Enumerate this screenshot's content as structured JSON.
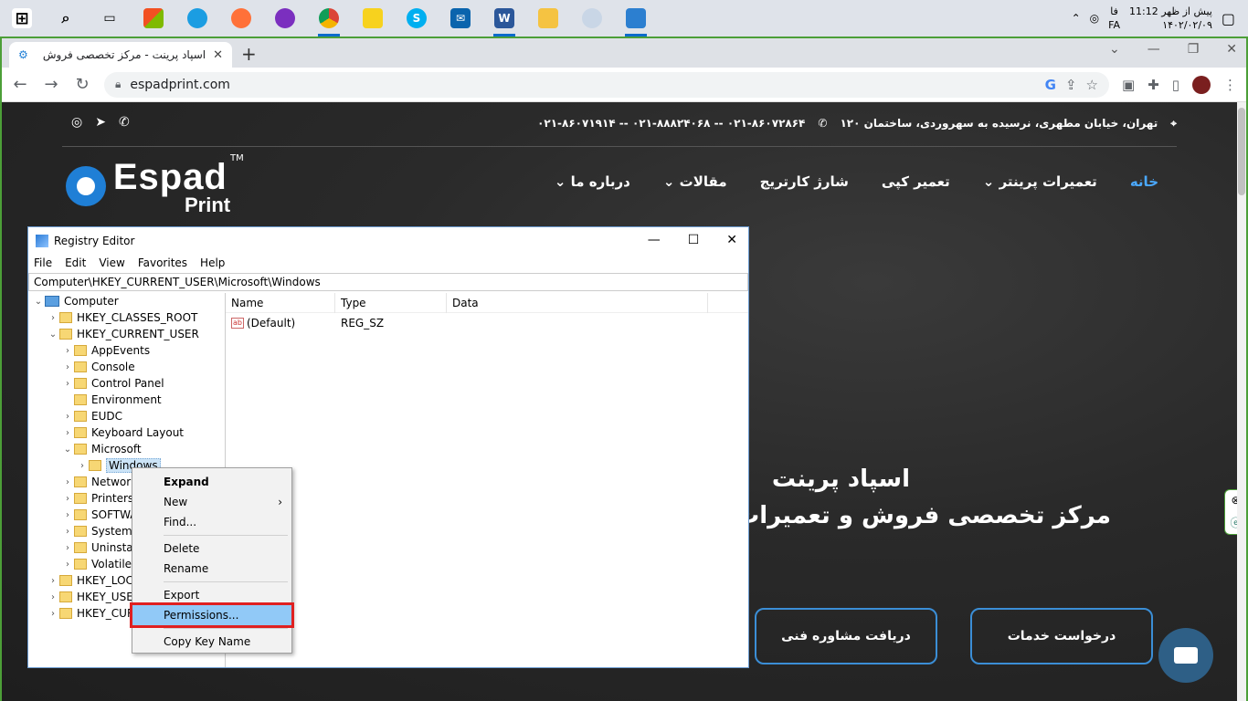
{
  "taskbar": {
    "icons": [
      "windows-start-icon",
      "search-icon",
      "task-view-icon",
      "store-icon",
      "edge-icon",
      "firefox-icon",
      "app-icon",
      "chrome-icon",
      "sticky-notes-icon",
      "skype-icon",
      "mail-icon",
      "word-icon",
      "file-explorer-icon",
      "paint-icon",
      "app2-icon"
    ],
    "tray": {
      "time_line1": "پیش از ظهر 11:12",
      "time_line2": "۱۴۰۲/۰۲/۰۹",
      "lang_line1": "فا",
      "lang_line2": "FA"
    }
  },
  "browser": {
    "tab_title": "اسپاد پرینت - مرکز تخصصی فروش",
    "tab_close": "✕",
    "new_tab": "+",
    "url": "espadprint.com",
    "min": "—",
    "max": "❐",
    "close": "✕"
  },
  "site": {
    "address": "تهران، خیابان مطهری، نرسیده به سهروردی، ساختمان ۱۲۰",
    "phones": "۰۲۱-۸۶۰۷۲۸۶۴ -- ۰۲۱-۸۸۸۲۴۰۶۸ -- ۰۲۱-۸۶۰۷۱۹۱۴",
    "logo_main": "Espad",
    "logo_sub": "Print",
    "logo_tm": "TM",
    "nav": [
      "خانه",
      "تعمیرات پرینتر",
      "تعمیر کپی",
      "شارژ کارتریج",
      "مقالات",
      "درباره ما"
    ],
    "hero_title": "اسپاد پرینت",
    "hero_sub": "مرکز تخصصی فروش و تعمیرات",
    "cta_services": "درخواست خدمات",
    "cta_consult": "دریافت مشاوره فنی"
  },
  "regedit": {
    "title": "Registry Editor",
    "menu": [
      "File",
      "Edit",
      "View",
      "Favorites",
      "Help"
    ],
    "address": "Computer\\HKEY_CURRENT_USER\\Microsoft\\Windows",
    "tree": [
      {
        "label": "Computer",
        "level": 0,
        "exp": "⌄",
        "type": "pc"
      },
      {
        "label": "HKEY_CLASSES_ROOT",
        "level": 1,
        "exp": "›"
      },
      {
        "label": "HKEY_CURRENT_USER",
        "level": 1,
        "exp": "⌄"
      },
      {
        "label": "AppEvents",
        "level": 2,
        "exp": "›"
      },
      {
        "label": "Console",
        "level": 2,
        "exp": "›"
      },
      {
        "label": "Control Panel",
        "level": 2,
        "exp": "›"
      },
      {
        "label": "Environment",
        "level": 2,
        "exp": ""
      },
      {
        "label": "EUDC",
        "level": 2,
        "exp": "›"
      },
      {
        "label": "Keyboard Layout",
        "level": 2,
        "exp": "›"
      },
      {
        "label": "Microsoft",
        "level": 2,
        "exp": "⌄"
      },
      {
        "label": "Windows",
        "level": 3,
        "exp": "›",
        "selected": true
      },
      {
        "label": "Network",
        "level": 2,
        "exp": "›"
      },
      {
        "label": "Printers",
        "level": 2,
        "exp": "›"
      },
      {
        "label": "SOFTWARE",
        "level": 2,
        "exp": "›"
      },
      {
        "label": "System",
        "level": 2,
        "exp": "›"
      },
      {
        "label": "Uninstall",
        "level": 2,
        "exp": "›"
      },
      {
        "label": "Volatile",
        "level": 2,
        "exp": "›"
      },
      {
        "label": "HKEY_LOCAL_MACHINE",
        "level": 1,
        "exp": "›"
      },
      {
        "label": "HKEY_USERS",
        "level": 1,
        "exp": "›"
      },
      {
        "label": "HKEY_CURRENT_CONFIG",
        "level": 1,
        "exp": "›"
      }
    ],
    "columns": [
      "Name",
      "Type",
      "Data"
    ],
    "values": [
      {
        "name": "(Default)",
        "type": "REG_SZ",
        "data": ""
      }
    ]
  },
  "context_menu": {
    "groups": [
      [
        {
          "label": "Expand",
          "bold": true
        },
        {
          "label": "New",
          "submenu": true
        },
        {
          "label": "Find..."
        }
      ],
      [
        {
          "label": "Delete"
        },
        {
          "label": "Rename"
        }
      ],
      [
        {
          "label": "Export"
        },
        {
          "label": "Permissions...",
          "highlighted": true
        }
      ],
      [
        {
          "label": "Copy Key Name"
        }
      ]
    ]
  }
}
